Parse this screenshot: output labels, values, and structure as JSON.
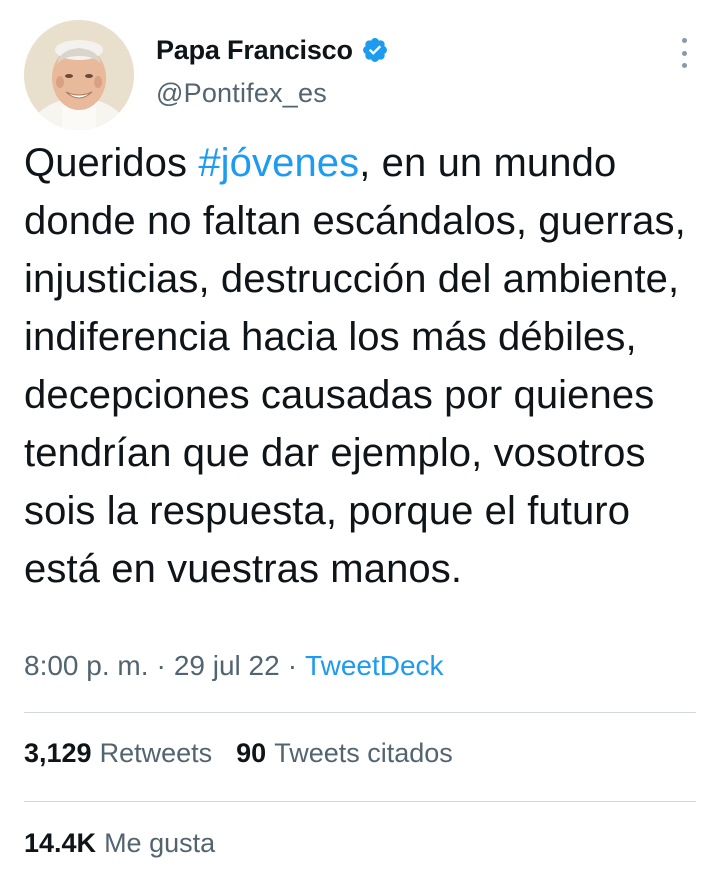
{
  "author": {
    "display_name": "Papa Francisco",
    "handle": "@Pontifex_es",
    "avatar_icon": "pope-portrait-avatar",
    "verified_icon": "verified-badge-icon"
  },
  "tweet": {
    "text_prefix": "Queridos ",
    "hashtag": "#jóvenes",
    "text_suffix": ", en un mundo donde no faltan escándalos, guerras, injusticias, destrucción del ambiente, indiferencia hacia los más débiles, decepciones causadas por quienes tendrían que dar ejemplo, vosotros sois la respuesta, porque el futuro está en vuestras manos."
  },
  "meta": {
    "time": "8:00 p. m.",
    "separator": "·",
    "date": "29 jul 22",
    "source": "TweetDeck"
  },
  "stats": {
    "retweets_count": "3,129",
    "retweets_label": "Retweets",
    "quotes_count": "90",
    "quotes_label": "Tweets citados",
    "likes_count": "14.4K",
    "likes_label": "Me gusta"
  },
  "colors": {
    "link": "#1d9bf0",
    "secondary_text": "#536471",
    "primary_text": "#0f1419",
    "divider": "#cfd9de"
  }
}
